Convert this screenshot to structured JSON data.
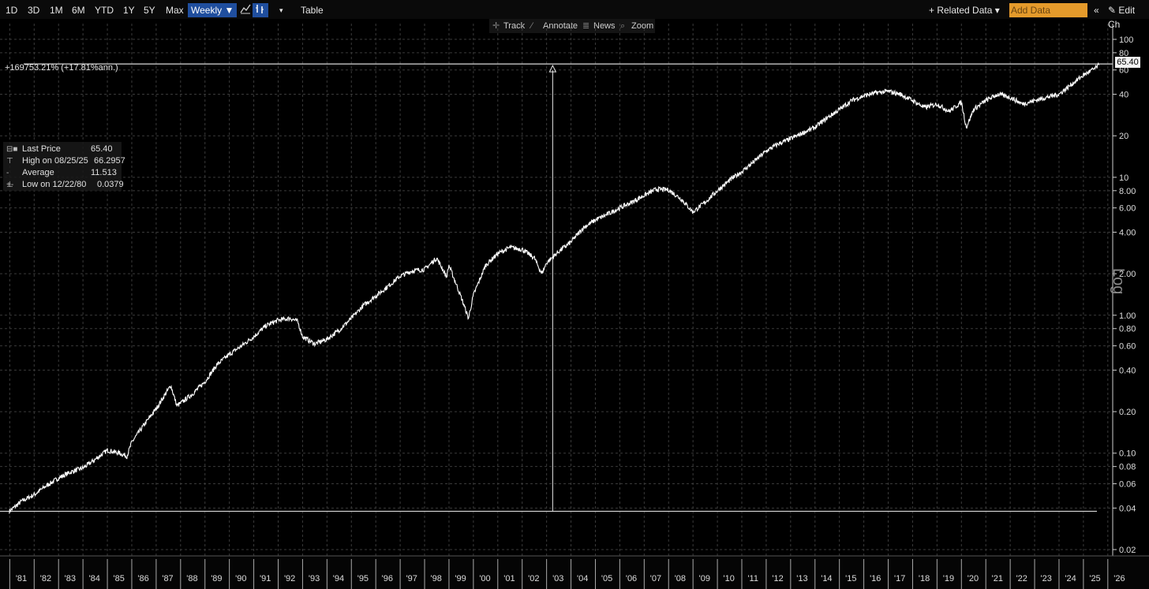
{
  "toolbar": {
    "periods": [
      "1D",
      "3D",
      "1M",
      "6M",
      "YTD",
      "1Y",
      "5Y",
      "Max"
    ],
    "frequency": "Weekly ▼",
    "table_label": "Table",
    "related_data": "+ Related Data ▾",
    "add_data_placeholder": "Add Data",
    "collapse_glyph": "«",
    "edit_chart": "✎ Edit Ch"
  },
  "subbar": {
    "track": "Track",
    "annotate": "Annotate",
    "news": "News",
    "zoom": "Zoom"
  },
  "legend": {
    "last_price_label": "Last Price",
    "last_price_value": "65.40",
    "high_label": "High on 08/25/25",
    "high_value": "66.2957",
    "average_label": "Average",
    "average_value": "11.513",
    "low_label": "Low on 12/22/80",
    "low_value": "0.0379"
  },
  "annotation": {
    "performance": "+169753.21% (+17.81%ann.)",
    "last_tag": "65.40"
  },
  "axis": {
    "scale_label": "Log"
  },
  "colors": {
    "background": "#000000",
    "line": "#ffffff",
    "grid": "#3a3a3a",
    "accent_orange": "#e59a2b",
    "selected_blue": "#1f4e9e"
  },
  "chart_data": {
    "type": "line",
    "yscale": "log",
    "frequency": "weekly",
    "grid": true,
    "ylim": [
      0.018,
      130
    ],
    "xlim": [
      1980.6,
      2026.2
    ],
    "y_ticks": [
      0.02,
      0.04,
      0.06,
      0.08,
      0.1,
      0.2,
      0.4,
      0.6,
      0.8,
      1.0,
      2.0,
      4.0,
      6.0,
      8.0,
      10,
      20,
      40,
      60,
      80,
      100
    ],
    "y_tick_labels": [
      "0.02",
      "0.04",
      "0.06",
      "0.08",
      "0.10",
      "0.20",
      "0.40",
      "0.60",
      "0.80",
      "1.00",
      "2.00",
      "4.00",
      "6.00",
      "8.00",
      "10",
      "20",
      "40",
      "60",
      "80",
      "100"
    ],
    "x_tick_labels": [
      "'81",
      "'82",
      "'83",
      "'84",
      "'85",
      "'86",
      "'87",
      "'88",
      "'89",
      "'90",
      "'91",
      "'92",
      "'93",
      "'94",
      "'95",
      "'96",
      "'97",
      "'98",
      "'99",
      "'00",
      "'01",
      "'02",
      "'03",
      "'04",
      "'05",
      "'06",
      "'07",
      "'08",
      "'09",
      "'10",
      "'11",
      "'12",
      "'13",
      "'14",
      "'15",
      "'16",
      "'17",
      "'18",
      "'19",
      "'20",
      "'21",
      "'22",
      "'23",
      "'24",
      "'25",
      "'26"
    ],
    "x": [
      1980.98,
      1981.5,
      1982.0,
      1982.5,
      1983.0,
      1983.5,
      1984.0,
      1984.5,
      1985.0,
      1985.5,
      1985.8,
      1986.0,
      1986.5,
      1987.0,
      1987.6,
      1987.85,
      1988.0,
      1988.5,
      1989.0,
      1989.5,
      1990.0,
      1990.5,
      1991.0,
      1991.5,
      1992.0,
      1992.5,
      1992.8,
      1993.0,
      1993.5,
      1994.0,
      1994.5,
      1995.0,
      1995.5,
      1996.0,
      1996.5,
      1997.0,
      1997.5,
      1998.0,
      1998.5,
      1998.9,
      1999.0,
      1999.5,
      1999.8,
      2000.0,
      2000.5,
      2001.0,
      2001.5,
      2002.0,
      2002.5,
      2002.8,
      2003.0,
      2003.5,
      2004.0,
      2004.5,
      2005.0,
      2005.5,
      2006.0,
      2006.5,
      2007.0,
      2007.5,
      2008.0,
      2008.5,
      2009.0,
      2009.5,
      2010.0,
      2010.5,
      2011.0,
      2011.5,
      2012.0,
      2012.5,
      2013.0,
      2013.5,
      2014.0,
      2014.5,
      2015.0,
      2015.5,
      2016.0,
      2016.5,
      2017.0,
      2017.5,
      2018.0,
      2018.5,
      2019.0,
      2019.5,
      2020.0,
      2020.2,
      2020.5,
      2021.0,
      2021.5,
      2022.0,
      2022.5,
      2023.0,
      2023.5,
      2024.0,
      2024.5,
      2025.0,
      2025.5,
      2025.65
    ],
    "values": [
      0.0379,
      0.045,
      0.05,
      0.058,
      0.066,
      0.073,
      0.078,
      0.09,
      0.105,
      0.1,
      0.095,
      0.12,
      0.16,
      0.21,
      0.31,
      0.22,
      0.23,
      0.27,
      0.33,
      0.44,
      0.52,
      0.6,
      0.7,
      0.84,
      0.92,
      0.95,
      0.9,
      0.7,
      0.62,
      0.67,
      0.78,
      0.95,
      1.18,
      1.38,
      1.62,
      1.92,
      2.1,
      2.15,
      2.6,
      1.9,
      2.3,
      1.35,
      0.95,
      1.4,
      2.3,
      2.8,
      3.1,
      3.0,
      2.6,
      2.0,
      2.4,
      2.9,
      3.4,
      4.3,
      4.9,
      5.4,
      6.0,
      6.6,
      7.4,
      8.2,
      8.1,
      7.0,
      5.6,
      6.6,
      8.0,
      9.5,
      11.0,
      13.0,
      15.5,
      17.5,
      19.0,
      21.0,
      23.0,
      27.0,
      31.0,
      36.0,
      39.0,
      41.0,
      42.0,
      40.0,
      36.0,
      32.0,
      34.0,
      30.0,
      35.0,
      23.0,
      31.0,
      36.0,
      40.0,
      38.0,
      34.0,
      36.0,
      38.0,
      40.0,
      47.0,
      55.0,
      62.0,
      65.4
    ]
  }
}
